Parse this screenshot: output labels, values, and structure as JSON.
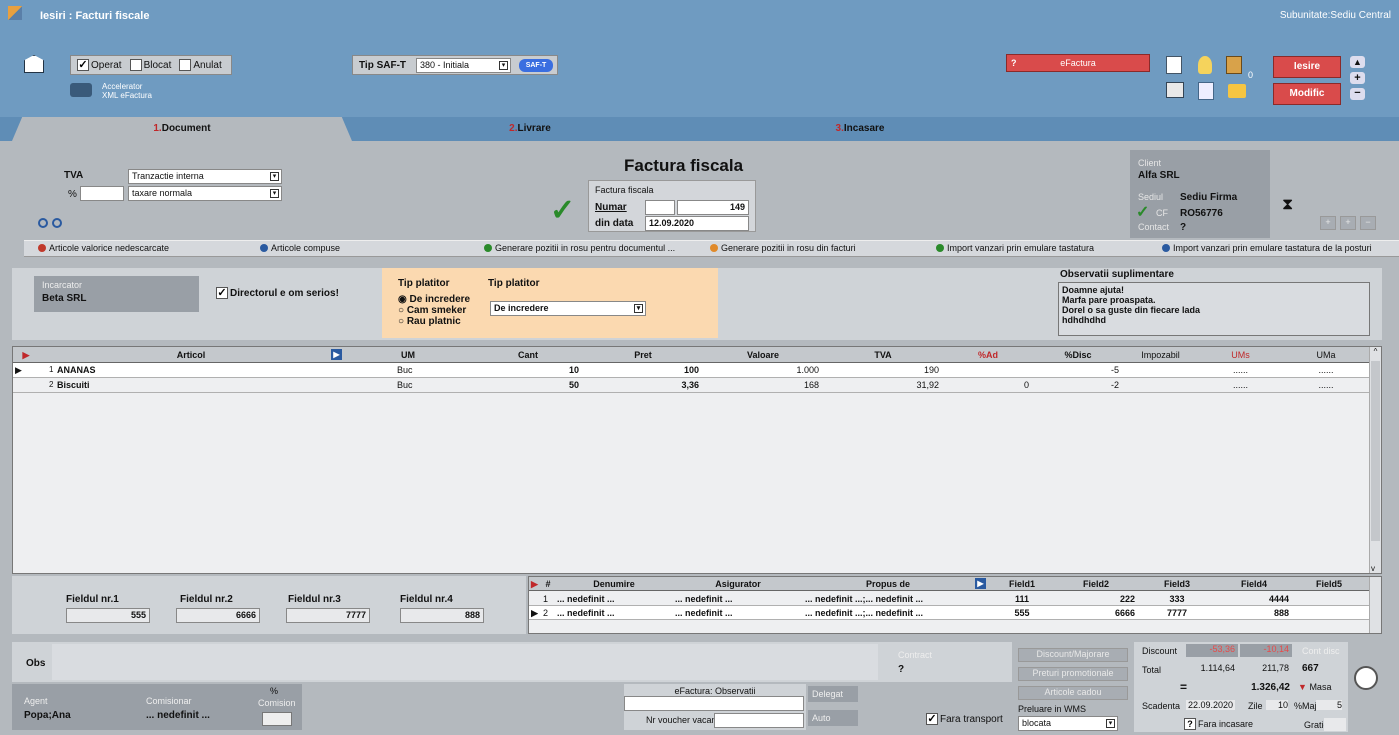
{
  "window": {
    "title": "Iesiri : Facturi fiscale",
    "subunit": "Subunitate:Sediu Central"
  },
  "toolbar": {
    "operat": "Operat",
    "blocat": "Blocat",
    "anulat": "Anulat",
    "accelerator": "Accelerator",
    "xml": "XML eFactura",
    "saft_label": "Tip SAF-T",
    "saft_value": "380 - Initiala",
    "saft_btn": "SAF-T",
    "efactura": "eFactura",
    "efactura_q": "?",
    "iesire": "Iesire",
    "modific": "Modific",
    "count": "0"
  },
  "tabs": [
    {
      "num": "1.",
      "label": "Document"
    },
    {
      "num": "2.",
      "label": "Livrare"
    },
    {
      "num": "3.",
      "label": "Incasare"
    }
  ],
  "tva": {
    "label": "TVA",
    "pct_label": "%",
    "tranzactie": "Tranzactie interna",
    "taxare": "taxare normala"
  },
  "factura": {
    "heading": "Factura fiscala",
    "box_title": "Factura fiscala",
    "numar_label": "Numar",
    "numar": "149",
    "data_label": "din data",
    "data": "12.09.2020"
  },
  "client": {
    "label": "Client",
    "name": "Alfa SRL",
    "sediul_label": "Sediul",
    "sediul": "Sediu Firma",
    "cf_label": "CF",
    "cf": "RO56776",
    "contact_label": "Contact",
    "contact": "?"
  },
  "actions": [
    "Articole valorice nedescarcate",
    "Articole compuse",
    "Generare pozitii in rosu pentru documentul ...",
    "Generare pozitii in rosu din facturi",
    "Import vanzari prin emulare tastatura",
    "Import vanzari prin emulare tastatura de la posturi"
  ],
  "incarcator": {
    "label": "Incarcator",
    "name": "Beta SRL",
    "director": "Directorul e om serios!"
  },
  "platitor": {
    "title1": "Tip platitor",
    "title2": "Tip platitor",
    "options": [
      "De incredere",
      "Cam smeker",
      "Rau platnic"
    ],
    "selected": "De incredere"
  },
  "observatii": {
    "label": "Observatii suplimentare",
    "lines": [
      "Doamne ajuta!",
      "Marfa pare proaspata.",
      "Dorel o sa guste din fiecare lada",
      "hdhdhdhd"
    ]
  },
  "grid": {
    "headers": [
      "Articol",
      "UM",
      "Cant",
      "Pret",
      "Valoare",
      "TVA",
      "%Ad",
      "%Disc",
      "Impozabil",
      "UMs",
      "UMa"
    ],
    "rows": [
      {
        "n": "1",
        "articol": "ANANAS",
        "um": "Buc",
        "cant": "10",
        "pret": "100",
        "valoare": "1.000",
        "tva": "190",
        "ad": "",
        "disc": "-5",
        "impozabil": "",
        "ums": "......",
        "uma": "......"
      },
      {
        "n": "2",
        "articol": "Biscuiti",
        "um": "Buc",
        "cant": "50",
        "pret": "3,36",
        "valoare": "168",
        "tva": "31,92",
        "ad": "0",
        "disc": "-2",
        "impozabil": "",
        "ums": "......",
        "uma": "......"
      }
    ]
  },
  "fields": [
    {
      "label": "Fieldul nr.1",
      "value": "555"
    },
    {
      "label": "Fieldul nr.2",
      "value": "6666"
    },
    {
      "label": "Fieldul nr.3",
      "value": "7777"
    },
    {
      "label": "Fieldul nr.4",
      "value": "888"
    }
  ],
  "subgrid": {
    "headers": [
      "#",
      "Denumire",
      "Asigurator",
      "Propus de",
      "Field1",
      "Field2",
      "Field3",
      "Field4",
      "Field5"
    ],
    "rows": [
      {
        "n": "1",
        "den": "... nedefinit ...",
        "asig": "... nedefinit ...",
        "prop": "... nedefinit ...;... nedefinit ...",
        "f1": "111",
        "f2": "222",
        "f3": "333",
        "f4": "4444",
        "f5": ""
      },
      {
        "n": "2",
        "den": "... nedefinit ...",
        "asig": "... nedefinit ...",
        "prop": "... nedefinit ...;... nedefinit ...",
        "f1": "555",
        "f2": "6666",
        "f3": "7777",
        "f4": "888",
        "f5": ""
      }
    ]
  },
  "bottom": {
    "obs": "Obs",
    "contract": "Contract",
    "contract_val": "?",
    "agent_label": "Agent",
    "agent": "Popa;Ana",
    "comisionar_label": "Comisionar",
    "comisionar": "... nedefinit ...",
    "comision_pct": "%",
    "comision": "Comision",
    "efact_obs": "eFactura: Observatii",
    "voucher": "Nr voucher vacanta",
    "delegat": "Delegat",
    "auto": "Auto",
    "fara_transport": "Fara transport",
    "discount_btn": "Discount/Majorare",
    "preturi": "Preturi promotionale",
    "cadou": "Articole cadou",
    "wms_label": "Preluare in WMS",
    "wms": "blocata"
  },
  "totals": {
    "discount_label": "Discount",
    "disc1": "-53,36",
    "disc2": "-10,14",
    "cont_disc_label": "Cont disc",
    "cont_disc": "667",
    "total_label": "Total",
    "total1": "1.114,64",
    "total2": "211,78",
    "eq": "=",
    "grand": "1.326,42",
    "masa": "Masa",
    "scad_label": "Scadenta",
    "scad": "22.09.2020",
    "zile_label": "Zile",
    "zile": "10",
    "maj_label": "%Maj",
    "maj": "5",
    "fara_incasare": "Fara incasare",
    "gratie": "Gratie"
  }
}
